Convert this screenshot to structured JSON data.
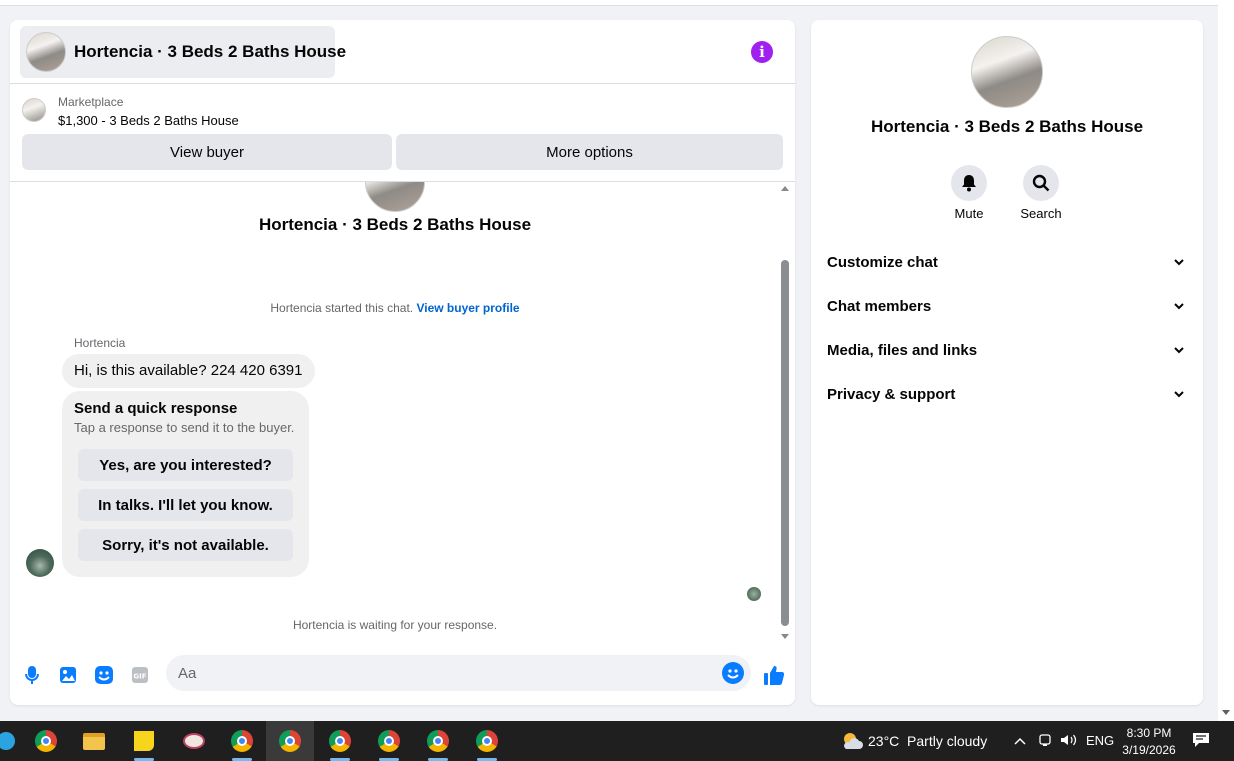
{
  "chat": {
    "title": "Hortencia · 3 Beds 2 Baths House",
    "marketplace_label": "Marketplace",
    "listing": "$1,300 - 3 Beds 2 Baths House",
    "view_buyer": "View buyer",
    "more_options": "More options",
    "convo_title": "Hortencia · 3 Beds 2 Baths House",
    "started_text": "Hortencia started this chat.",
    "view_buyer_profile": "View buyer profile",
    "sender_name": "Hortencia",
    "message": "Hi, is this available? 224 420 6391",
    "quick_response": {
      "title": "Send a quick response",
      "subtitle": "Tap a response to send it to the buyer.",
      "options": [
        "Yes, are you interested?",
        "In talks. I'll let you know.",
        "Sorry, it's not available."
      ]
    },
    "waiting": "Hortencia is waiting for your response.",
    "input_placeholder": "Aa"
  },
  "details": {
    "title": "Hortencia · 3 Beds 2 Baths House",
    "mute": "Mute",
    "search": "Search",
    "sections": [
      "Customize chat",
      "Chat members",
      "Media, files and links",
      "Privacy & support"
    ]
  },
  "taskbar": {
    "weather": "23°C  Partly cloudy",
    "lang": "ENG",
    "time": "8:30 PM",
    "date": "3/19/2026"
  },
  "colors": {
    "accent": "#0a7cff",
    "info": "#a020f0",
    "link": "#0064d1"
  }
}
